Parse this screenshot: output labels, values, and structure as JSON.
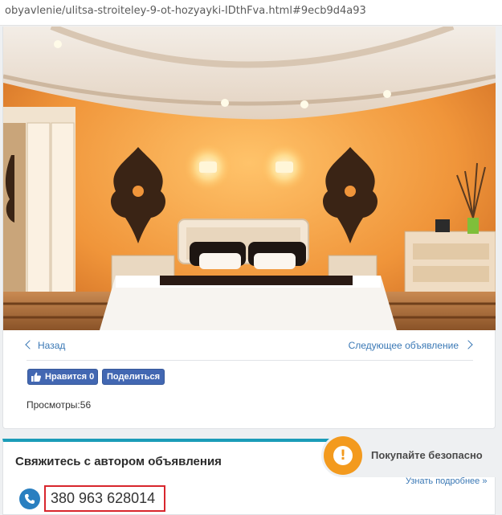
{
  "browser": {
    "url": "obyavlenie/ulitsa-stroiteley-9-ot-hozyayki-IDthFva.html#9ecb9d4a93"
  },
  "listing": {
    "photo_alt": "bedroom-photo",
    "nav": {
      "prev_label": "Назад",
      "next_label": "Следующее объявление"
    },
    "social": {
      "like_label": "Нравится 0",
      "share_label": "Поделиться"
    },
    "views_label": "Просмотры:",
    "views_count": "56"
  },
  "contact": {
    "title": "Свяжитесь с автором объявления",
    "phone": "380 963 628014"
  },
  "safe_buy": {
    "label": "Покупайте безопасно",
    "icon_glyph": "!",
    "learn_more": "Узнать подробнее »"
  },
  "colors": {
    "link": "#3a78b5",
    "facebook": "#4267b2",
    "accent_teal": "#1b9cb8",
    "highlight_red": "#d8262d",
    "safe_orange": "#f39a1e",
    "phone_blue": "#2a7fc0"
  },
  "icons": {
    "prev": "chevron-left-icon",
    "next": "chevron-right-icon",
    "like": "thumbs-up-icon",
    "phone": "phone-icon",
    "safe": "exclamation-bubble-icon"
  }
}
